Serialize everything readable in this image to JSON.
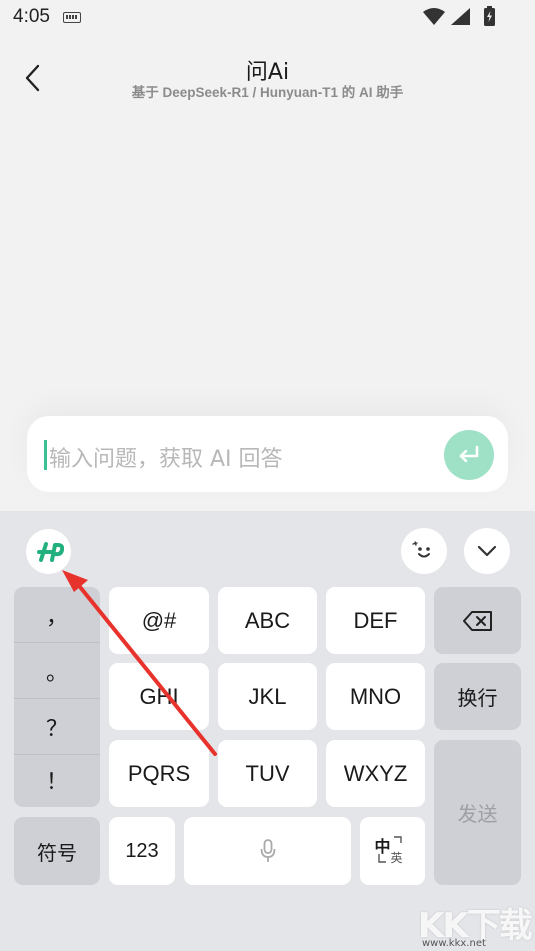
{
  "status_bar": {
    "time": "4:05"
  },
  "header": {
    "title": "问Ai",
    "subtitle": "基于 DeepSeek-R1 / Hunyuan-T1 的 AI 助手"
  },
  "input": {
    "placeholder": "输入问题，获取 AI 回答"
  },
  "keyboard": {
    "punctuation": [
      "，",
      "。",
      "？",
      "！"
    ],
    "rows": [
      [
        "@#",
        "ABC",
        "DEF"
      ],
      [
        "GHI",
        "JKL",
        "MNO"
      ],
      [
        "PQRS",
        "TUV",
        "WXYZ"
      ]
    ],
    "newline_label": "换行",
    "send_label": "发送",
    "symbols_label": "符号",
    "numbers_label": "123",
    "lang_top": "中",
    "lang_bottom": "英"
  },
  "watermark": {
    "logo_text": "KK下载",
    "url": "www.kkx.net"
  },
  "colors": {
    "accent": "#3bbf94",
    "send_circle": "#9ee1c6",
    "annotation_arrow": "#e8322c"
  },
  "icons": [
    "keyboard-status-icon",
    "wifi-icon",
    "signal-icon",
    "battery-icon",
    "back-arrow-icon",
    "send-enter-icon",
    "keyboard-logo-icon",
    "emoji-face-icon",
    "collapse-chevron-icon",
    "backspace-icon",
    "microphone-icon"
  ]
}
